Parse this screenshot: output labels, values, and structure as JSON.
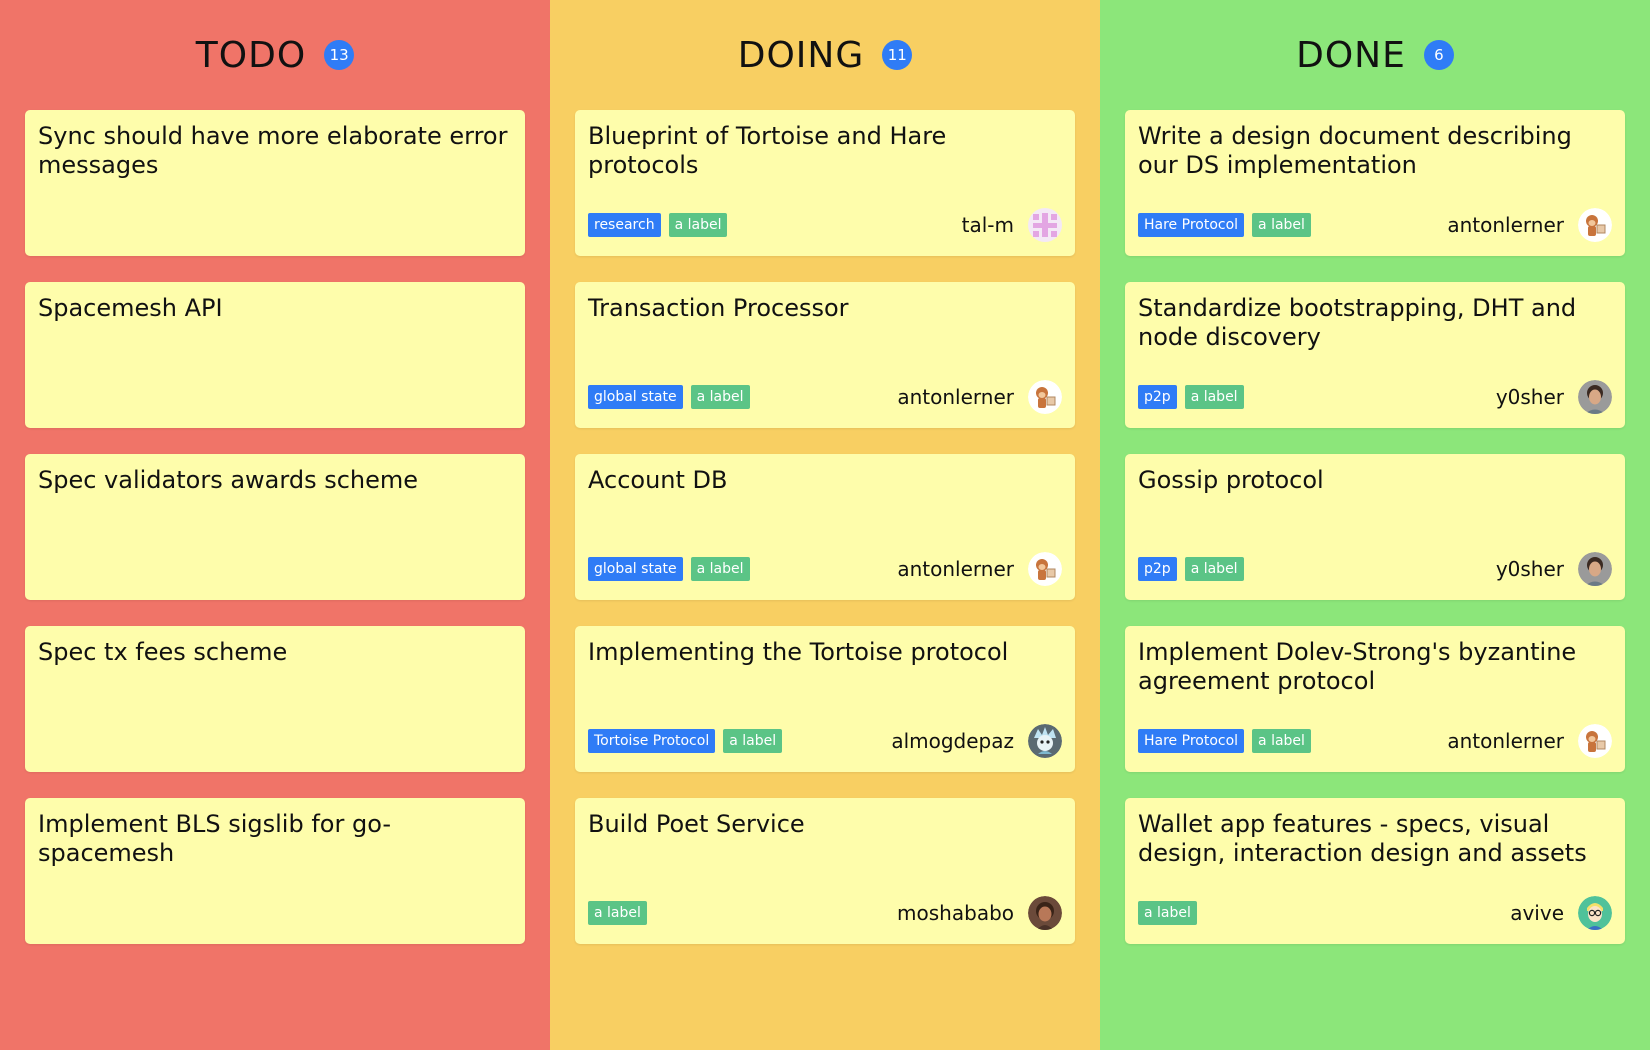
{
  "columns": [
    {
      "id": "todo",
      "title": "TODO",
      "count": "13",
      "cards": [
        {
          "title": "Sync should have more elaborate error messages",
          "labels": [],
          "assignee": "",
          "avatar": ""
        },
        {
          "title": "Spacemesh API",
          "labels": [],
          "assignee": "",
          "avatar": ""
        },
        {
          "title": "Spec validators awards scheme",
          "labels": [],
          "assignee": "",
          "avatar": ""
        },
        {
          "title": "Spec tx fees scheme",
          "labels": [],
          "assignee": "",
          "avatar": ""
        },
        {
          "title": "Implement BLS sigslib for go-spacemesh",
          "labels": [],
          "assignee": "",
          "avatar": ""
        }
      ]
    },
    {
      "id": "doing",
      "title": "DOING",
      "count": "11",
      "cards": [
        {
          "title": "Blueprint of Tortoise and Hare protocols",
          "labels": [
            {
              "text": "research",
              "color": "blue"
            },
            {
              "text": "a label",
              "color": "green"
            }
          ],
          "assignee": "tal-m",
          "avatar": "identicon-avatar"
        },
        {
          "title": "Transaction Processor",
          "labels": [
            {
              "text": "global state",
              "color": "blue"
            },
            {
              "text": "a label",
              "color": "green"
            }
          ],
          "assignee": "antonlerner",
          "avatar": "monkey-avatar"
        },
        {
          "title": "Account DB",
          "labels": [
            {
              "text": "global state",
              "color": "blue"
            },
            {
              "text": "a label",
              "color": "green"
            }
          ],
          "assignee": "antonlerner",
          "avatar": "monkey-avatar"
        },
        {
          "title": "Implementing the Tortoise protocol",
          "labels": [
            {
              "text": "Tortoise Protocol",
              "color": "blue"
            },
            {
              "text": "a label",
              "color": "green"
            }
          ],
          "assignee": "almogdepaz",
          "avatar": "cartoon-avatar"
        },
        {
          "title": "Build Poet Service",
          "labels": [
            {
              "text": "a label",
              "color": "green"
            }
          ],
          "assignee": "moshababo",
          "avatar": "photo-avatar"
        }
      ]
    },
    {
      "id": "done",
      "title": "DONE",
      "count": "6",
      "cards": [
        {
          "title": "Write a design document describing our DS implementation",
          "labels": [
            {
              "text": "Hare Protocol",
              "color": "blue"
            },
            {
              "text": "a label",
              "color": "green"
            }
          ],
          "assignee": "antonlerner",
          "avatar": "monkey-avatar"
        },
        {
          "title": "Standardize bootstrapping, DHT and node discovery",
          "labels": [
            {
              "text": "p2p",
              "color": "blue"
            },
            {
              "text": "a label",
              "color": "green"
            }
          ],
          "assignee": "y0sher",
          "avatar": "photo-avatar"
        },
        {
          "title": "Gossip protocol",
          "labels": [
            {
              "text": "p2p",
              "color": "blue"
            },
            {
              "text": "a label",
              "color": "green"
            }
          ],
          "assignee": "y0sher",
          "avatar": "photo-avatar"
        },
        {
          "title": "Implement Dolev-Strong's byzantine agreement protocol",
          "labels": [
            {
              "text": "Hare Protocol",
              "color": "blue"
            },
            {
              "text": "a label",
              "color": "green"
            }
          ],
          "assignee": "antonlerner",
          "avatar": "monkey-avatar"
        },
        {
          "title": "Wallet app features - specs, visual design, interaction design and assets",
          "labels": [
            {
              "text": "a label",
              "color": "green"
            }
          ],
          "assignee": "avive",
          "avatar": "glasses-avatar"
        }
      ]
    }
  ],
  "colors": {
    "todo_bg": "#f07468",
    "doing_bg": "#f8cf62",
    "done_bg": "#8ce67a",
    "card_bg": "#fefdab",
    "badge": "#2f7cf6",
    "label_blue": "#2f7cf6",
    "label_green": "#5bc486"
  }
}
